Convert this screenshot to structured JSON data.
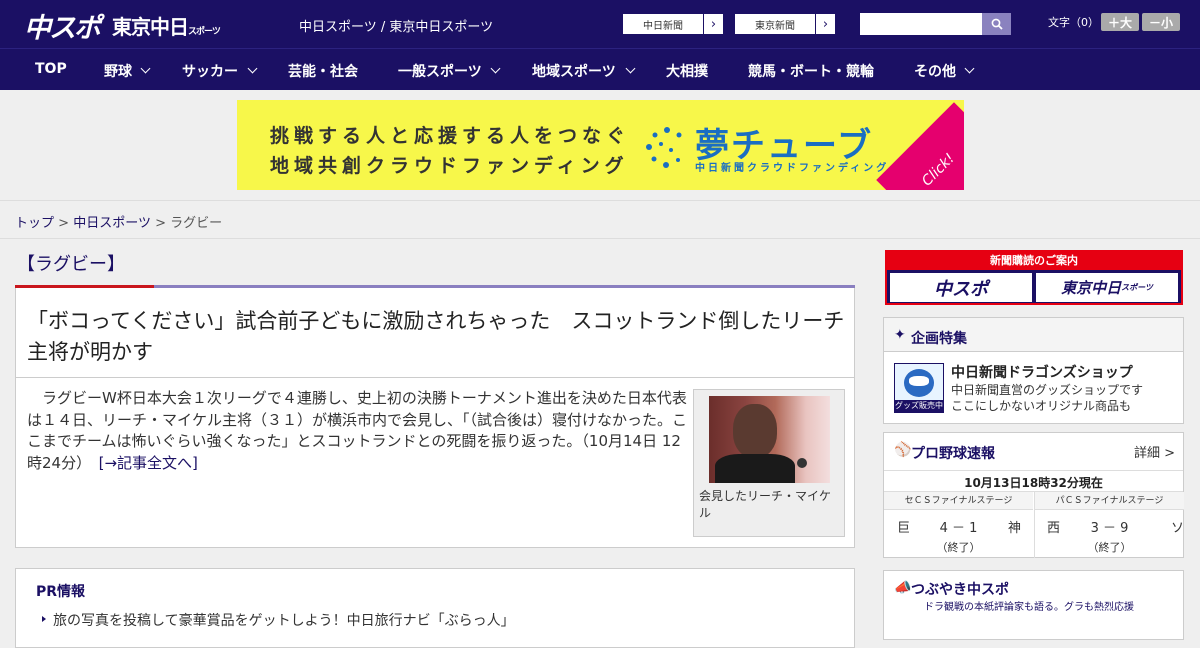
{
  "header": {
    "logo_chuspo": "中スポ",
    "logo_tokyo": "東京中日",
    "logo_tokyo_small": "スポーツ",
    "sites": "中日スポーツ / 東京中日スポーツ",
    "paper_buttons": [
      "中日新聞",
      "東京新聞"
    ],
    "search_placeholder": "",
    "font_label": "文字（0）",
    "font_larger": "＋大",
    "font_smaller": "－小"
  },
  "nav": {
    "items": [
      "TOP",
      "野球",
      "サッカー",
      "芸能・社会",
      "一般スポーツ",
      "地域スポーツ",
      "大相撲",
      "競馬・ボート・競輪",
      "その他"
    ]
  },
  "banner": {
    "line1": "挑戦する人と応援する人をつなぐ",
    "line2": "地域共創クラウドファンディング",
    "brand": "夢チューブ",
    "sub": "中日新聞クラウドファンディング",
    "click": "Click!"
  },
  "breadcrumb": {
    "items": [
      "トップ",
      "中日スポーツ",
      "ラグビー"
    ],
    "sep": ">"
  },
  "article": {
    "category": "【ラグビー】",
    "headline": "「ボコってください」試合前子どもに激励されちゃった　スコットランド倒したリーチ主将が明かす",
    "body": "　ラグビーW杯日本大会１次リーグで４連勝し、史上初の決勝トーナメント進出を決めた日本代表は１４日、リーチ・マイケル主将（３１）が横浜市内で会見し、「（試合後は）寝付けなかった。ここまでチームは怖いぐらい強くなった」とスコットランドとの死闘を振り返った。（10月14日 12時24分）",
    "more": "[→記事全文へ]",
    "photo_caption": "会見したリーチ・マイケル"
  },
  "pr": {
    "title": "PR情報",
    "items": [
      "旅の写真を投稿して豪華賞品をゲットしよう！中日旅行ナビ「ぶらっ人」"
    ]
  },
  "sidebar": {
    "subscribe": {
      "title": "新聞購読のご案内",
      "left": "中スポ",
      "right": "東京中日",
      "right_small": "スポーツ"
    },
    "kikaku": {
      "title": "企画特集",
      "shop_label": "グッズ販売中",
      "shop_title": "中日新聞ドラゴンズショップ",
      "shop_desc1": "中日新聞直営のグッズショップです",
      "shop_desc2": "ここにしかないオリジナル商品も"
    },
    "baseball": {
      "title": "プロ野球速報",
      "detail": "詳細 >",
      "time": "10月13日18時32分現在",
      "games": [
        {
          "stage": "セＣＳファイナルステージ",
          "home": "巨",
          "score": "4 － 1",
          "away": "神",
          "status": "（終了）"
        },
        {
          "stage": "パＣＳファイナルステージ",
          "home": "西",
          "score": "3 － 9",
          "away": "ソ",
          "status": "（終了）"
        }
      ]
    },
    "tsubuyaki": {
      "title": "つぶやき中スポ",
      "sub": "ドラ観戦の本紙評論家も語る。グラも熱烈応援"
    }
  },
  "colors": {
    "brand_navy": "#1b1064",
    "accent_red": "#c9161d",
    "banner_yellow": "#f7f74a",
    "banner_pink": "#e5006e"
  }
}
